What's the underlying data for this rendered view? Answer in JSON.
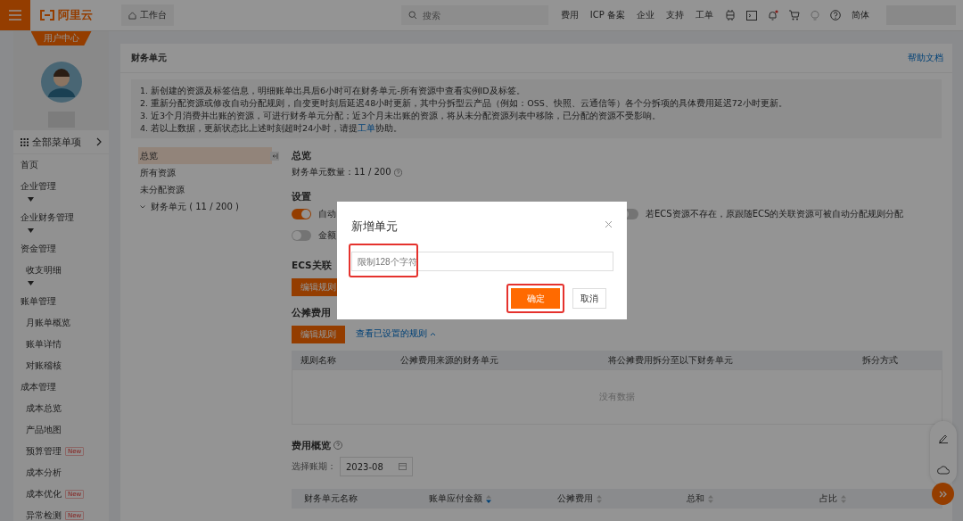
{
  "topbar": {
    "brand": "阿里云",
    "home_tab": "工作台",
    "search": {
      "placeholder": "搜索"
    },
    "links": [
      "费用",
      "ICP 备案",
      "企业",
      "支持",
      "工单"
    ],
    "language": "简体"
  },
  "sidebar": {
    "tab": "用户中心",
    "all_menu": "全部菜单项",
    "menu": [
      {
        "label": "首页",
        "collapsible": false
      },
      {
        "label": "企业管理",
        "collapsible": true
      },
      {
        "label": "企业财务管理",
        "collapsible": true
      },
      {
        "label": "资金管理",
        "collapsible": true,
        "children": [
          {
            "label": "收支明细"
          }
        ]
      },
      {
        "label": "账单管理",
        "collapsible": false,
        "children": [
          {
            "label": "月账单概览"
          },
          {
            "label": "账单详情"
          },
          {
            "label": "对账稽核"
          }
        ]
      },
      {
        "label": "成本管理",
        "collapsible": false,
        "children": [
          {
            "label": "成本总览"
          },
          {
            "label": "产品地图"
          },
          {
            "label": "预算管理",
            "badge": "New"
          },
          {
            "label": "成本分析"
          },
          {
            "label": "成本优化",
            "badge": "New"
          },
          {
            "label": "异常检测",
            "badge": "New"
          }
        ]
      }
    ]
  },
  "page": {
    "title": "财务单元",
    "help_link": "帮助文档"
  },
  "notice": [
    {
      "text": "1. 新创建的资源及标签信息，明细账单出具后6小时可在财务单元-所有资源中查看实例ID及标签。"
    },
    {
      "text": "2. 重新分配资源或修改自动分配规则，自变更时刻后延迟48小时更新，其中分拆型云产品（例如：OSS、快照、云通信等）各个分拆项的具体费用延迟72小时更新。"
    },
    {
      "text": "3. 近3个月消费并出账的资源，可进行财务单元分配；近3个月未出账的资源，将从未分配资源列表中移除，已分配的资源不受影响。"
    },
    {
      "text": "4. 若以上数据，更新状态比上述时刻超时24小时，请提",
      "link": "工单",
      "after": "协助。"
    }
  ],
  "nav": [
    {
      "label": "总览",
      "selected": true
    },
    {
      "label": "所有资源",
      "selected": false
    },
    {
      "label": "未分配资源",
      "selected": false
    },
    {
      "label": "财务单元 ( 11 / 200 )",
      "selected": false,
      "expanded": true
    }
  ],
  "overview": {
    "title": "总览",
    "count_label": "财务单元数量：",
    "count": "11 / 200"
  },
  "settings": {
    "title": "设置",
    "toggles": [
      {
        "label": "自动",
        "on": true
      },
      {
        "label": "若ECS资源不存在，原跟随ECS的关联资源可被自动分配规则分配",
        "on": false
      },
      {
        "label": "金额",
        "on": false
      }
    ]
  },
  "ecs_rules": {
    "title": "ECS关联",
    "button": "编辑规则"
  },
  "split_rules": {
    "title": "公摊费用",
    "button": "编辑规则",
    "link": "查看已设置的规则",
    "columns": [
      "规则名称",
      "公摊费用来源的财务单元",
      "将公摊费用拆分至以下财务单元",
      "拆分方式"
    ],
    "empty": "没有数据"
  },
  "cost_overview": {
    "title": "费用概览",
    "period_label": "选择账期：",
    "period": "2023-08",
    "columns": [
      {
        "label": "财务单元名称",
        "sortable": false,
        "sorted": false
      },
      {
        "label": "账单应付金额",
        "sortable": true,
        "sorted": true
      },
      {
        "label": "公摊费用",
        "sortable": true,
        "sorted": false
      },
      {
        "label": "总和",
        "sortable": true,
        "sorted": false
      },
      {
        "label": "占比",
        "sortable": true,
        "sorted": false
      }
    ]
  },
  "modal": {
    "title": "新增单元",
    "input": {
      "placeholder": "限制128个字符",
      "highlighted": true
    },
    "buttons": [
      {
        "label": "确定",
        "kind": "primary",
        "highlighted": true
      },
      {
        "label": "取消",
        "kind": "secondary",
        "highlighted": false
      }
    ]
  }
}
